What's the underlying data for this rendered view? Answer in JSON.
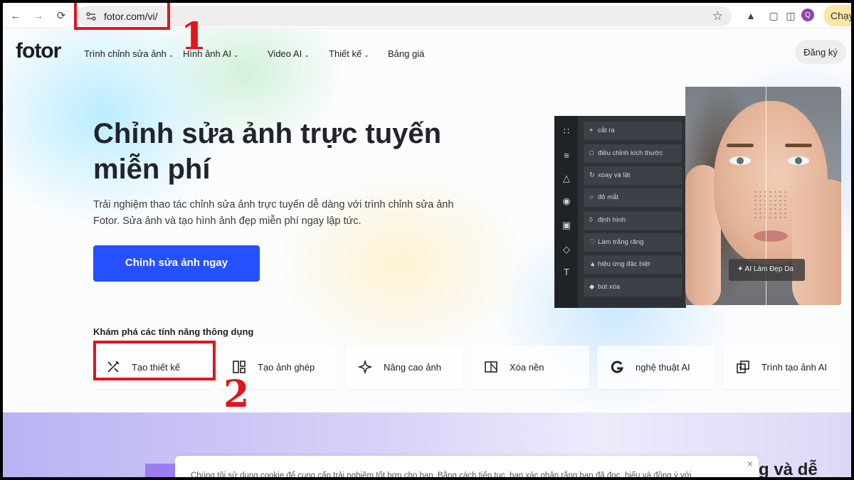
{
  "browser": {
    "url": "fotor.com/vi/",
    "avatar_letter": "Q",
    "run_label": "Chạy"
  },
  "site": {
    "logo": "fotor",
    "menu": [
      {
        "label": "Trình chỉnh sửa ảnh"
      },
      {
        "label": "Hình ảnh AI"
      },
      {
        "label": "Video AI"
      },
      {
        "label": "Thiết kế"
      },
      {
        "label": "Bảng giá"
      }
    ],
    "signup_label": "Đăng ký"
  },
  "hero": {
    "title_line1": "Chỉnh sửa ảnh trực tuyến",
    "title_line2": "miễn phí",
    "desc_line1": "Trải nghiệm thao tác chỉnh sửa ảnh trực tuyến dễ dàng với trình chỉnh sửa ảnh",
    "desc_line2": "Fotor. Sửa ảnh và tạo hình ảnh đẹp miễn phí ngay lập tức.",
    "cta_label": "Chỉnh sửa ảnh ngay"
  },
  "editor_mock": {
    "tools": [
      "cắt ra",
      "điều chỉnh kích thước",
      "xoay và lật",
      "đỏ mắt",
      "định hình",
      "Làm trắng răng",
      "hiệu ứng đặc biệt",
      "bút xóa"
    ],
    "ai_badge": "AI Làm Đẹp Da"
  },
  "features": {
    "heading": "Khám phá các tính năng thông dụng",
    "cards": [
      {
        "label": "Tạo thiết kế"
      },
      {
        "label": "Tạo ảnh ghép"
      },
      {
        "label": "Nâng cao ảnh"
      },
      {
        "label": "Xóa nền"
      },
      {
        "label": "nghệ thuật AI"
      },
      {
        "label": "Trình tạo ảnh AI"
      }
    ]
  },
  "cookie": {
    "text": "Chúng tôi sử dụng cookie để cung cấp trải nghiệm tốt hơn cho bạn. Bằng cách tiếp tục, bạn xác nhận rằng bạn đã đọc, hiểu và đồng ý với",
    "close": "×"
  },
  "bottom": {
    "title_fragment": "g và dễ"
  },
  "annotations": {
    "step1": "1",
    "step2": "2",
    "color": "#e3141b"
  },
  "colors": {
    "accent": "#2450ff"
  }
}
